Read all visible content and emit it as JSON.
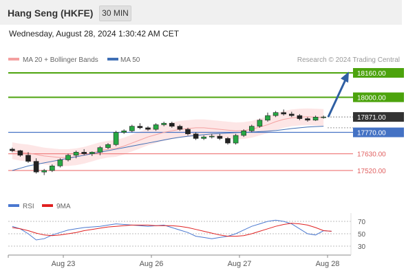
{
  "header": {
    "title": "Hang Seng (HKFE)",
    "timeframe": "30 MIN"
  },
  "datetime": "Wednesday, August 28, 2024 1:30:42 AM CET",
  "legend": {
    "bb_label": "MA 20 + Bollinger Bands",
    "ma50_label": "MA 50",
    "credit": "Research © 2024 Trading Central"
  },
  "rsi_legend": {
    "rsi_label": "RSI",
    "ma_label": "9MA"
  },
  "colors": {
    "resistance": "#4ca30d",
    "support": "#f08080",
    "pivot": "#4472c4",
    "current": "#333333",
    "arrow": "#2f5fa3",
    "ma20": "#f4a0a0",
    "ma50": "#3f6fb5",
    "band": "#fde3e3",
    "rsi": "#4a78d0",
    "rsi_ma": "#e02020"
  },
  "levels": [
    {
      "value": "18160.00",
      "kind": "resistance"
    },
    {
      "value": "18000.00",
      "kind": "resistance"
    },
    {
      "value": "17871.00",
      "kind": "current"
    },
    {
      "value": "17770.00",
      "kind": "pivot"
    },
    {
      "value": "17630.00",
      "kind": "support"
    },
    {
      "value": "17520.00",
      "kind": "support"
    }
  ],
  "chart_data": [
    {
      "type": "candlestick",
      "title": "Hang Seng (HKFE) 30 MIN",
      "x_ticks": [
        "Aug 23",
        "Aug 26",
        "Aug 27",
        "Aug 28"
      ],
      "ylim": [
        17470,
        18200
      ],
      "series": [
        {
          "name": "MA 20 + Bollinger Bands",
          "values": [
            17650,
            17640,
            17635,
            17625,
            17615,
            17610,
            17605,
            17605,
            17610,
            17620,
            17635,
            17650,
            17660,
            17665,
            17680,
            17700,
            17720,
            17740,
            17755,
            17770,
            17780,
            17790,
            17795,
            17800,
            17800,
            17795,
            17790,
            17785,
            17780,
            17782,
            17790,
            17805,
            17820,
            17840,
            17855,
            17865,
            17870,
            17872,
            17870,
            17868
          ]
        },
        {
          "name": "MA 50",
          "values": [
            17520,
            17535,
            17550,
            17560,
            17570,
            17580,
            17590,
            17600,
            17610,
            17620,
            17630,
            17640,
            17650,
            17660,
            17670,
            17680,
            17690,
            17700,
            17710,
            17720,
            17730,
            17738,
            17745,
            17750,
            17755,
            17760,
            17762,
            17765,
            17768,
            17770,
            17772,
            17775,
            17778,
            17782,
            17788,
            17795,
            17800,
            17805,
            17808,
            17810
          ]
        }
      ],
      "candles": [
        [
          17660,
          17670,
          17640,
          17650
        ],
        [
          17650,
          17655,
          17610,
          17620
        ],
        [
          17620,
          17640,
          17570,
          17580
        ],
        [
          17580,
          17600,
          17500,
          17510
        ],
        [
          17510,
          17530,
          17490,
          17520
        ],
        [
          17520,
          17560,
          17510,
          17550
        ],
        [
          17550,
          17600,
          17540,
          17590
        ],
        [
          17590,
          17630,
          17580,
          17620
        ],
        [
          17620,
          17650,
          17600,
          17640
        ],
        [
          17640,
          17660,
          17620,
          17630
        ],
        [
          17630,
          17645,
          17615,
          17640
        ],
        [
          17640,
          17680,
          17620,
          17670
        ],
        [
          17670,
          17700,
          17660,
          17690
        ],
        [
          17690,
          17780,
          17680,
          17770
        ],
        [
          17770,
          17790,
          17760,
          17780
        ],
        [
          17780,
          17820,
          17770,
          17810
        ],
        [
          17810,
          17830,
          17790,
          17800
        ],
        [
          17800,
          17810,
          17780,
          17790
        ],
        [
          17790,
          17830,
          17780,
          17820
        ],
        [
          17820,
          17840,
          17810,
          17830
        ],
        [
          17830,
          17840,
          17800,
          17810
        ],
        [
          17810,
          17820,
          17780,
          17790
        ],
        [
          17790,
          17800,
          17750,
          17760
        ],
        [
          17760,
          17770,
          17720,
          17730
        ],
        [
          17730,
          17750,
          17720,
          17740
        ],
        [
          17740,
          17760,
          17730,
          17745
        ],
        [
          17745,
          17760,
          17720,
          17730
        ],
        [
          17730,
          17740,
          17690,
          17700
        ],
        [
          17700,
          17760,
          17690,
          17750
        ],
        [
          17750,
          17790,
          17740,
          17780
        ],
        [
          17780,
          17820,
          17770,
          17810
        ],
        [
          17810,
          17860,
          17800,
          17850
        ],
        [
          17850,
          17900,
          17840,
          17880
        ],
        [
          17880,
          17910,
          17870,
          17900
        ],
        [
          17900,
          17920,
          17880,
          17890
        ],
        [
          17890,
          17905,
          17870,
          17880
        ],
        [
          17880,
          17890,
          17850,
          17860
        ],
        [
          17860,
          17870,
          17840,
          17850
        ],
        [
          17850,
          17880,
          17845,
          17870
        ],
        [
          17870,
          17880,
          17860,
          17871
        ]
      ],
      "rsi": {
        "values": [
          62,
          58,
          50,
          40,
          42,
          48,
          52,
          56,
          58,
          60,
          61,
          62,
          64,
          66,
          65,
          64,
          63,
          62,
          63,
          64,
          60,
          56,
          52,
          46,
          44,
          42,
          44,
          46,
          50,
          56,
          62,
          66,
          70,
          72,
          70,
          66,
          58,
          50,
          48,
          55,
          54
        ]
      },
      "rsi_ma": {
        "values": [
          60,
          58,
          55,
          51,
          48,
          47,
          48,
          50,
          52,
          55,
          57,
          59,
          61,
          62,
          63,
          64,
          64,
          64,
          63,
          63,
          63,
          62,
          60,
          57,
          54,
          51,
          48,
          46,
          46,
          47,
          50,
          54,
          58,
          62,
          65,
          67,
          66,
          64,
          60,
          55,
          54
        ]
      },
      "rsi_ticks": [
        "70",
        "50",
        "30"
      ]
    }
  ]
}
